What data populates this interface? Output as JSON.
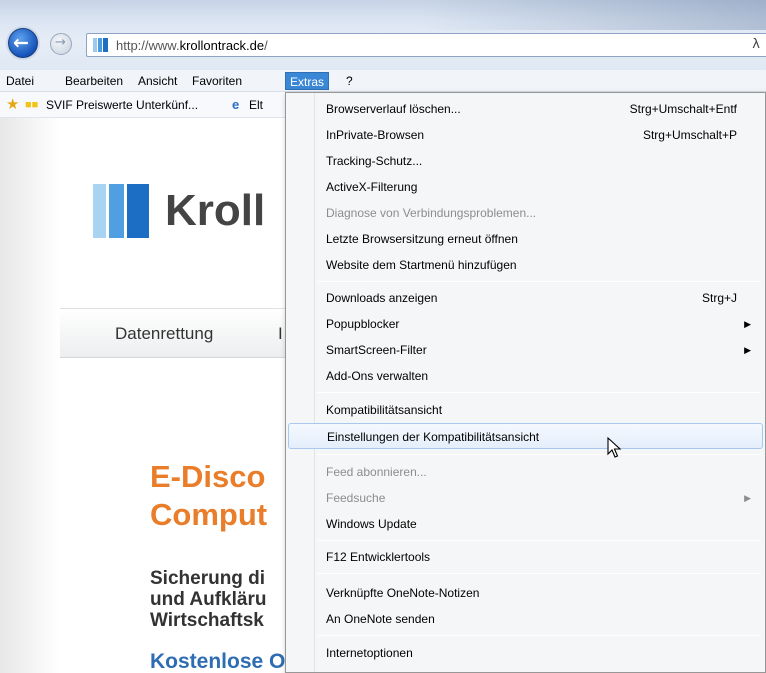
{
  "browser": {
    "url_prefix": "http://www.",
    "url_domain": "krollontrack.de",
    "url_suffix": "/",
    "address_tail": "λ"
  },
  "menubar": {
    "items": [
      "Datei",
      "Bearbeiten",
      "Ansicht",
      "Favoriten",
      "Extras",
      "?"
    ],
    "active": "Extras"
  },
  "favorites": {
    "item1": "SVIF Preiswerte Unterkünf...",
    "item2": "Elt"
  },
  "page": {
    "logo_text": "Kroll",
    "nav_item": "Datenrettung",
    "nav_item_partial": "I",
    "headline": "E-Disco\nComput",
    "subtext": "Sicherung di\nund Aufkläru\nWirtschaftsk",
    "link_text": "Kostenlose Online-Anfrage",
    "colors": {
      "headline": "#ea7d2a",
      "link": "#2f6db3",
      "logo": "#1e7fd0"
    }
  },
  "extras_menu": {
    "items": [
      {
        "label": "Browserverlauf löschen...",
        "shortcut": "Strg+Umschalt+Entf"
      },
      {
        "label": "InPrivate-Browsen",
        "shortcut": "Strg+Umschalt+P"
      },
      {
        "label": "Tracking-Schutz...",
        "shortcut": ""
      },
      {
        "label": "ActiveX-Filterung",
        "shortcut": ""
      },
      {
        "label": "Diagnose von Verbindungsproblemen...",
        "shortcut": "",
        "disabled": true
      },
      {
        "label": "Letzte Browsersitzung erneut öffnen",
        "shortcut": ""
      },
      {
        "label": "Website dem Startmenü hinzufügen",
        "shortcut": ""
      },
      {
        "label": "Downloads anzeigen",
        "shortcut": "Strg+J"
      },
      {
        "label": "Popupblocker",
        "shortcut": "",
        "submenu": true
      },
      {
        "label": "SmartScreen-Filter",
        "shortcut": "",
        "submenu": true
      },
      {
        "label": "Add-Ons verwalten",
        "shortcut": ""
      },
      {
        "label": "Kompatibilitätsansicht",
        "shortcut": ""
      },
      {
        "label": "Einstellungen der Kompatibilitätsansicht",
        "shortcut": "",
        "highlighted": true
      },
      {
        "label": "Feed abonnieren...",
        "shortcut": "",
        "disabled": true
      },
      {
        "label": "Feedsuche",
        "shortcut": "",
        "disabled": true,
        "submenu": true
      },
      {
        "label": "Windows Update",
        "shortcut": ""
      },
      {
        "label": "F12 Entwicklertools",
        "shortcut": ""
      },
      {
        "label": "Verknüpfte OneNote-Notizen",
        "shortcut": ""
      },
      {
        "label": "An OneNote senden",
        "shortcut": ""
      },
      {
        "label": "Internetoptionen",
        "shortcut": ""
      }
    ]
  }
}
